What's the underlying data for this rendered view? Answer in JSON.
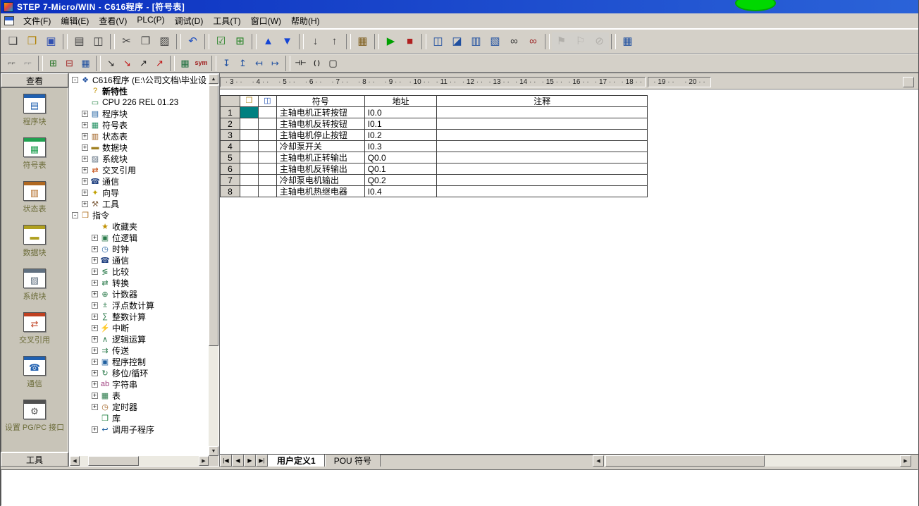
{
  "window": {
    "title": "STEP 7-Micro/WIN  -  C616程序  -  [符号表]"
  },
  "menu": {
    "items": [
      "文件(F)",
      "编辑(E)",
      "查看(V)",
      "PLC(P)",
      "调试(D)",
      "工具(T)",
      "窗口(W)",
      "帮助(H)"
    ]
  },
  "toolbar_main": {
    "buttons": [
      {
        "t": "b",
        "name": "new-file-button",
        "glyph": "❏",
        "color": "#404040"
      },
      {
        "t": "b",
        "name": "open-file-button",
        "glyph": "❒",
        "color": "#b08000"
      },
      {
        "t": "b",
        "name": "save-button",
        "glyph": "▣",
        "color": "#3050b0"
      },
      {
        "t": "s",
        "name": "toolbar-separator",
        "inter": "false"
      },
      {
        "t": "b",
        "name": "print-button",
        "glyph": "▤",
        "color": "#404040"
      },
      {
        "t": "b",
        "name": "print-preview-button",
        "glyph": "◫",
        "color": "#404040"
      },
      {
        "t": "s",
        "name": "toolbar-separator",
        "inter": "false"
      },
      {
        "t": "b",
        "name": "cut-button",
        "glyph": "✂",
        "color": "#404040"
      },
      {
        "t": "b",
        "name": "copy-button",
        "glyph": "❐",
        "color": "#404040"
      },
      {
        "t": "b",
        "name": "paste-button",
        "glyph": "▨",
        "color": "#404040"
      },
      {
        "t": "s",
        "name": "toolbar-separator",
        "inter": "false"
      },
      {
        "t": "b",
        "name": "undo-button",
        "glyph": "↶",
        "color": "#2050c0"
      },
      {
        "t": "s",
        "name": "toolbar-separator",
        "inter": "false"
      },
      {
        "t": "b",
        "name": "compile-button",
        "glyph": "☑",
        "color": "#208020"
      },
      {
        "t": "b",
        "name": "compile-all-button",
        "glyph": "⊞",
        "color": "#208020"
      },
      {
        "t": "s",
        "name": "toolbar-separator",
        "inter": "false"
      },
      {
        "t": "b",
        "name": "upload-button",
        "glyph": "▲",
        "color": "#1545d5"
      },
      {
        "t": "b",
        "name": "download-button",
        "glyph": "▼",
        "color": "#1545d5"
      },
      {
        "t": "s",
        "name": "toolbar-separator",
        "inter": "false"
      },
      {
        "t": "b",
        "name": "sort-ascending-button",
        "glyph": "↓",
        "color": "#404040"
      },
      {
        "t": "b",
        "name": "sort-descending-button",
        "glyph": "↑",
        "color": "#404040"
      },
      {
        "t": "s",
        "name": "toolbar-separator",
        "inter": "false"
      },
      {
        "t": "b",
        "name": "options-button",
        "glyph": "▦",
        "color": "#806020"
      },
      {
        "t": "s",
        "name": "toolbar-separator",
        "inter": "false"
      },
      {
        "t": "b",
        "name": "run-button",
        "glyph": "▶",
        "color": "#00a000"
      },
      {
        "t": "b",
        "name": "stop-button",
        "glyph": "■",
        "color": "#b02020"
      },
      {
        "t": "s",
        "name": "toolbar-separator",
        "inter": "false"
      },
      {
        "t": "b",
        "name": "program-status-button",
        "glyph": "◫",
        "color": "#2050a0"
      },
      {
        "t": "b",
        "name": "program-status-pause-button",
        "glyph": "◪",
        "color": "#2050a0"
      },
      {
        "t": "b",
        "name": "chart-status-button",
        "glyph": "▥",
        "color": "#2050a0"
      },
      {
        "t": "b",
        "name": "chart-status-pause-button",
        "glyph": "▧",
        "color": "#2050a0"
      },
      {
        "t": "b",
        "name": "read-all-button",
        "glyph": "∞",
        "color": "#404040"
      },
      {
        "t": "b",
        "name": "write-all-button",
        "glyph": "∞",
        "color": "#a03030"
      },
      {
        "t": "s",
        "name": "toolbar-separator",
        "inter": "false"
      },
      {
        "t": "b",
        "name": "force-button",
        "glyph": "⚑",
        "color": "#b08000",
        "disabled": true
      },
      {
        "t": "b",
        "name": "unforce-button",
        "glyph": "⚐",
        "color": "#b08000",
        "disabled": true
      },
      {
        "t": "b",
        "name": "unforce-all-button",
        "glyph": "⊘",
        "color": "#808080",
        "disabled": true
      },
      {
        "t": "s",
        "name": "toolbar-separator",
        "inter": "false"
      },
      {
        "t": "b",
        "name": "symbol-table-grid-button",
        "glyph": "▦",
        "color": "#2050a0"
      }
    ]
  },
  "toolbar_edit": {
    "buttons": [
      {
        "t": "b",
        "name": "toggle-pou-comments-button",
        "glyph": "⌐⌐",
        "color": "#404040"
      },
      {
        "t": "b",
        "name": "toggle-network-comments-button",
        "glyph": "⌐⌐",
        "color": "#808080"
      },
      {
        "t": "s",
        "name": "toolbar-separator",
        "inter": "false"
      },
      {
        "t": "b",
        "name": "insert-network-button",
        "glyph": "⊞",
        "color": "#207020"
      },
      {
        "t": "b",
        "name": "delete-network-button",
        "glyph": "⊟",
        "color": "#a02020"
      },
      {
        "t": "b",
        "name": "network-table-button",
        "glyph": "▦",
        "color": "#2050a0"
      },
      {
        "t": "s",
        "name": "toolbar-separator",
        "inter": "false"
      },
      {
        "t": "b",
        "name": "insert-row-button",
        "glyph": "↘",
        "color": "#202020"
      },
      {
        "t": "b",
        "name": "delete-row-button",
        "glyph": "↘",
        "color": "#c01010"
      },
      {
        "t": "b",
        "name": "insert-column-button",
        "glyph": "↗",
        "color": "#202020"
      },
      {
        "t": "b",
        "name": "delete-column-button",
        "glyph": "↗",
        "color": "#c01010"
      },
      {
        "t": "s",
        "name": "toolbar-separator",
        "inter": "false"
      },
      {
        "t": "b",
        "name": "symbol-info-table-button",
        "glyph": "▦",
        "color": "#207040"
      },
      {
        "t": "b",
        "name": "symbolic-addressing-button",
        "glyph": "sym",
        "color": "#a02020"
      },
      {
        "t": "s",
        "name": "toolbar-separator",
        "inter": "false"
      },
      {
        "t": "b",
        "name": "line-down-button",
        "glyph": "↧",
        "color": "#2050a0"
      },
      {
        "t": "b",
        "name": "line-up-button",
        "glyph": "↥",
        "color": "#2050a0"
      },
      {
        "t": "b",
        "name": "line-left-button",
        "glyph": "↤",
        "color": "#2050a0"
      },
      {
        "t": "b",
        "name": "line-right-button",
        "glyph": "↦",
        "color": "#2050a0"
      },
      {
        "t": "s",
        "name": "toolbar-separator",
        "inter": "false"
      },
      {
        "t": "b",
        "name": "contact-button",
        "glyph": "⊣⊢",
        "color": "#202020"
      },
      {
        "t": "b",
        "name": "coil-button",
        "glyph": "( )",
        "color": "#202020"
      },
      {
        "t": "b",
        "name": "box-button",
        "glyph": "▢",
        "color": "#202020"
      }
    ]
  },
  "view_bar": {
    "header": "查看",
    "footer": "工具",
    "items": [
      {
        "name": "sidebar-item-program-block",
        "label": "程序块",
        "glyph": "▤",
        "color": "#2060b0"
      },
      {
        "name": "sidebar-item-symbol-table",
        "label": "符号表",
        "glyph": "▦",
        "color": "#20a050"
      },
      {
        "name": "sidebar-item-status-chart",
        "label": "状态表",
        "glyph": "▥",
        "color": "#b06820"
      },
      {
        "name": "sidebar-item-data-block",
        "label": "数据块",
        "glyph": "▬",
        "color": "#b0a020"
      },
      {
        "name": "sidebar-item-system-block",
        "label": "系统块",
        "glyph": "▨",
        "color": "#607080"
      },
      {
        "name": "sidebar-item-cross-reference",
        "label": "交叉引用",
        "glyph": "⇄",
        "color": "#c04020"
      },
      {
        "name": "sidebar-item-communications",
        "label": "通信",
        "glyph": "☎",
        "color": "#2060b0"
      },
      {
        "name": "sidebar-item-pg-pc-interface",
        "label": "设置 PG/PC 接口",
        "glyph": "⚙",
        "color": "#505050"
      }
    ]
  },
  "project_tree": {
    "items": [
      {
        "name": "tree-item-project-root",
        "label": "C616程序 (E:\\公司文档\\毕业设",
        "glyph": "❖",
        "color": "#2050a0",
        "expand": "-",
        "level": 0
      },
      {
        "name": "tree-item-new-features",
        "label": "新特性",
        "glyph": "?",
        "color": "#c09000",
        "expand": "",
        "level": 1,
        "bold": true
      },
      {
        "name": "tree-item-cpu",
        "label": "CPU 226 REL 01.23",
        "glyph": "▭",
        "color": "#208040",
        "expand": "",
        "level": 1
      },
      {
        "name": "tree-item-program-block",
        "label": "程序块",
        "glyph": "▤",
        "color": "#2060a0",
        "expand": "+",
        "level": 1
      },
      {
        "name": "tree-item-symbol-table",
        "label": "符号表",
        "glyph": "▦",
        "color": "#209060",
        "expand": "+",
        "level": 1
      },
      {
        "name": "tree-item-status-chart",
        "label": "状态表",
        "glyph": "▥",
        "color": "#a06020",
        "expand": "+",
        "level": 1
      },
      {
        "name": "tree-item-data-block",
        "label": "数据块",
        "glyph": "▬",
        "color": "#a08020",
        "expand": "+",
        "level": 1
      },
      {
        "name": "tree-item-system-block",
        "label": "系统块",
        "glyph": "▨",
        "color": "#607080",
        "expand": "+",
        "level": 1
      },
      {
        "name": "tree-item-cross-reference",
        "label": "交叉引用",
        "glyph": "⇄",
        "color": "#c04000",
        "expand": "+",
        "level": 1
      },
      {
        "name": "tree-item-communications",
        "label": "通信",
        "glyph": "☎",
        "color": "#204080",
        "expand": "+",
        "level": 1
      },
      {
        "name": "tree-item-wizards",
        "label": "向导",
        "glyph": "✦",
        "color": "#c0a000",
        "expand": "+",
        "level": 1
      },
      {
        "name": "tree-item-tools",
        "label": "工具",
        "glyph": "⚒",
        "color": "#806040",
        "expand": "+",
        "level": 1
      },
      {
        "name": "tree-item-instructions",
        "label": "指令",
        "glyph": "❒",
        "color": "#b07020",
        "expand": "-",
        "level": 0
      },
      {
        "name": "tree-item-favorites",
        "label": "收藏夹",
        "glyph": "★",
        "color": "#c09000",
        "expand": "",
        "level": 2
      },
      {
        "name": "tree-item-bit-logic",
        "label": "位逻辑",
        "glyph": "▣",
        "color": "#2a7a4a",
        "expand": "+",
        "level": 2
      },
      {
        "name": "tree-item-clock",
        "label": "时钟",
        "glyph": "◷",
        "color": "#2060a0",
        "expand": "+",
        "level": 2
      },
      {
        "name": "tree-item-communications-instr",
        "label": "通信",
        "glyph": "☎",
        "color": "#204080",
        "expand": "+",
        "level": 2
      },
      {
        "name": "tree-item-compare",
        "label": "比较",
        "glyph": "≶",
        "color": "#2a7a4a",
        "expand": "+",
        "level": 2
      },
      {
        "name": "tree-item-convert",
        "label": "转换",
        "glyph": "⇄",
        "color": "#2a7a4a",
        "expand": "+",
        "level": 2
      },
      {
        "name": "tree-item-counters",
        "label": "计数器",
        "glyph": "⊕",
        "color": "#2a7a4a",
        "expand": "+",
        "level": 2
      },
      {
        "name": "tree-item-floating-point-math",
        "label": "浮点数计算",
        "glyph": "±",
        "color": "#2a7a4a",
        "expand": "+",
        "level": 2
      },
      {
        "name": "tree-item-integer-math",
        "label": "整数计算",
        "glyph": "∑",
        "color": "#2a7a4a",
        "expand": "+",
        "level": 2
      },
      {
        "name": "tree-item-interrupt",
        "label": "中断",
        "glyph": "⚡",
        "color": "#a04000",
        "expand": "+",
        "level": 2
      },
      {
        "name": "tree-item-logical-operations",
        "label": "逻辑运算",
        "glyph": "∧",
        "color": "#2a7a4a",
        "expand": "+",
        "level": 2
      },
      {
        "name": "tree-item-move",
        "label": "传送",
        "glyph": "⇉",
        "color": "#2a7a4a",
        "expand": "+",
        "level": 2
      },
      {
        "name": "tree-item-program-control",
        "label": "程序控制",
        "glyph": "▣",
        "color": "#2060a0",
        "expand": "+",
        "level": 2
      },
      {
        "name": "tree-item-shift-rotate",
        "label": "移位/循环",
        "glyph": "↻",
        "color": "#2a7a4a",
        "expand": "+",
        "level": 2
      },
      {
        "name": "tree-item-string",
        "label": "字符串",
        "glyph": "ab",
        "color": "#a04080",
        "expand": "+",
        "level": 2
      },
      {
        "name": "tree-item-table",
        "label": "表",
        "glyph": "▦",
        "color": "#2a7a4a",
        "expand": "+",
        "level": 2
      },
      {
        "name": "tree-item-timers",
        "label": "定时器",
        "glyph": "◷",
        "color": "#a06020",
        "expand": "+",
        "level": 2
      },
      {
        "name": "tree-item-libraries",
        "label": "库",
        "glyph": "❒",
        "color": "#208040",
        "expand": "",
        "level": 2
      },
      {
        "name": "tree-item-call-subroutines",
        "label": "调用子程序",
        "glyph": "↩",
        "color": "#2060a0",
        "expand": "+",
        "level": 2
      }
    ]
  },
  "ruler": {
    "numbers_a": [
      3,
      4,
      5,
      6,
      7,
      8,
      9,
      10,
      11,
      12,
      13,
      14,
      15,
      16,
      17,
      18
    ],
    "numbers_b": [
      19,
      20
    ]
  },
  "symbol_table": {
    "columns": [
      "符号",
      "地址",
      "注释"
    ],
    "header_icons": [
      {
        "name": "folder-icon",
        "glyph": "❒",
        "color": "#b08820"
      },
      {
        "name": "monitor-icon",
        "glyph": "◫",
        "color": "#2050b0"
      }
    ],
    "rows": [
      {
        "num": 1,
        "symbol": "主轴电机正转按钮",
        "address": "I0.0",
        "comment": "",
        "selected": true
      },
      {
        "num": 2,
        "symbol": "主轴电机反转按钮",
        "address": "I0.1",
        "comment": ""
      },
      {
        "num": 3,
        "symbol": "主轴电机停止按钮",
        "address": "I0.2",
        "comment": ""
      },
      {
        "num": 4,
        "symbol": "冷却泵开关",
        "address": "I0.3",
        "comment": ""
      },
      {
        "num": 5,
        "symbol": "主轴电机正转输出",
        "address": "Q0.0",
        "comment": ""
      },
      {
        "num": 6,
        "symbol": "主轴电机反转输出",
        "address": "Q0.1",
        "comment": ""
      },
      {
        "num": 7,
        "symbol": "冷却泵电机输出",
        "address": "Q0.2",
        "comment": ""
      },
      {
        "num": 8,
        "symbol": "主轴电机热继电器",
        "address": "I0.4",
        "comment": ""
      }
    ]
  },
  "tabs": {
    "nav": [
      {
        "name": "first-tab-button",
        "glyph": "|◀"
      },
      {
        "name": "prev-tab-button",
        "glyph": "◀"
      },
      {
        "name": "next-tab-button",
        "glyph": "▶"
      },
      {
        "name": "last-tab-button",
        "glyph": "▶|"
      }
    ],
    "items": [
      {
        "name": "tab-user-defined-1",
        "label": "用户定义1",
        "active": true
      },
      {
        "name": "tab-pou-symbols",
        "label": "POU 符号"
      }
    ]
  },
  "colors": {
    "title_bar": "#0b2fc0",
    "chrome": "#D4D0C8",
    "cell_cursor": "#008080",
    "indicator": "#00d800"
  }
}
